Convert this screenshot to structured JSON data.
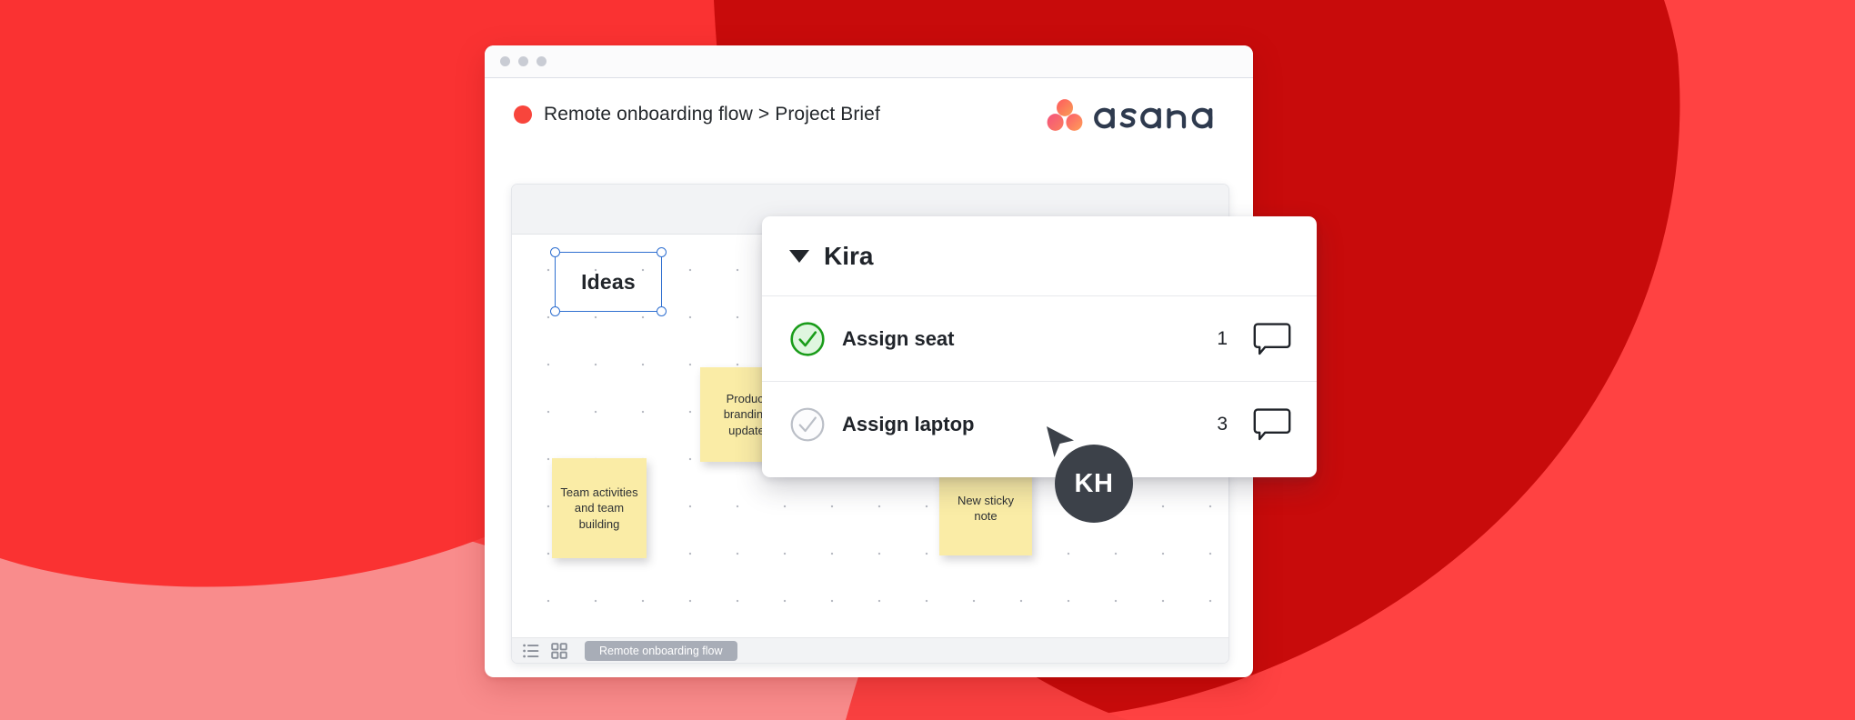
{
  "background": {
    "base_color": "#FF4242",
    "light_blob_color": "#F98C8C",
    "dark_blob_color": "#C80B0B",
    "bright_circle_color": "#FA3232"
  },
  "window": {
    "traffic_lights": [
      "close-dot",
      "minimize-dot",
      "maximize-dot"
    ],
    "breadcrumb": {
      "project_dot_color": "#F8453C",
      "project": "Remote onboarding flow",
      "separator": ">",
      "page": "Project Brief"
    },
    "brand": {
      "name": "asana",
      "logo_colors": [
        "#F06A6A",
        "#FC636B",
        "#F06A6A"
      ],
      "wordmark_color": "#2E3A4E"
    }
  },
  "canvas": {
    "shapes": [
      {
        "id": "ideas",
        "label": "Ideas",
        "selected": true,
        "selection_color": "#2f6fd0"
      }
    ],
    "sticky_notes": [
      {
        "id": "sticky-product",
        "text": "Product branding update",
        "color": "#FAECA6"
      },
      {
        "id": "sticky-team",
        "text": "Team activities and team building",
        "color": "#FAECA6"
      },
      {
        "id": "sticky-new",
        "text": "New sticky note",
        "color": "#FAECA6"
      }
    ],
    "footer": {
      "list_view_icon": "list-view-icon",
      "board_view_icon": "board-view-icon",
      "active_tab": "Remote onboarding flow"
    }
  },
  "popup": {
    "caret": "chevron-down-icon",
    "title": "Kira",
    "tasks": [
      {
        "name": "Assign seat",
        "completed": true,
        "check_color": "#1A9C1A",
        "check_fill": "#DFF6DF",
        "comment_count": "1"
      },
      {
        "name": "Assign laptop",
        "completed": false,
        "check_color": "#BBBFC7",
        "check_fill": "#FCFCFD",
        "comment_count": "3"
      }
    ]
  },
  "collaborator": {
    "cursor_icon": "pointer-cursor-icon",
    "initials": "KH",
    "color": "#3C4149"
  }
}
